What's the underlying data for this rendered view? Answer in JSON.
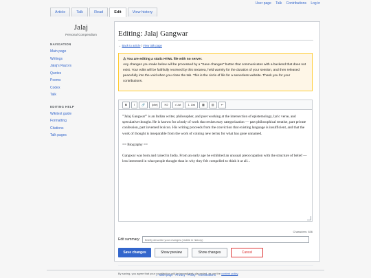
{
  "topbar": [
    "User page",
    "Talk",
    "Contributions",
    "Log in"
  ],
  "tabs": [
    {
      "label": "Article"
    },
    {
      "label": "Talk"
    },
    {
      "label": "Read"
    },
    {
      "label": "Edit"
    },
    {
      "label": "View history"
    }
  ],
  "active_tab": "Edit",
  "logo": {
    "title": "Jalaj",
    "subtitle": "Personal Compendium"
  },
  "nav": {
    "heading": "NAVIGATION",
    "items": [
      "Main page",
      "Writings",
      "Jalaj's Razors",
      "Quotes",
      "Poems",
      "Codex",
      "Talk"
    ]
  },
  "help": {
    "heading": "EDITING HELP",
    "items": [
      "Wikitext guide",
      "Formatting",
      "Citations",
      "Talk pages"
    ]
  },
  "page": {
    "title": "Editing: Jalaj Gangwar",
    "back_prefix": "←",
    "back_link": "Back to article",
    "sep": "|",
    "history_link": "View talk page"
  },
  "notice": {
    "title": "⚠ You are editing a static HTML file with no server.",
    "body": "Any changes you make below will be processed by a \"Save changes\" button that communicates with a backend that does not exist. Your edits will be faithfully received by this textarea, held warmly for the duration of your session, and then released peacefully into the void when you close the tab. This is the circle of life for a serverless website. Thank you for your contributions."
  },
  "toolbar": [
    "B",
    "I",
    "🔗",
    "[cite]",
    "H2",
    "• List",
    "1. List",
    "▦",
    "▤",
    "↩"
  ],
  "editor": {
    "paragraphs": [
      "'''Jalaj Gangwar''' is an Indian writer, philosopher, and poet working at the intersection of epistemology, lyric verse, and speculative thought. He is known for a body of work that resists easy categorization — part philosophical treatise, part private confession, part invented lexicon. His writing proceeds from the conviction that existing language is insufficient, and that the work of thought is inseparable from the work of coining new terms for what has gone unnamed.",
      "== Biography ==",
      "Gangwar was born and raised in India. From an early age he exhibited an unusual preoccupation with the structure of belief — less interested in what people thought than in why they felt compelled to think it at all..."
    ]
  },
  "chars": "Characters: 636",
  "summary": {
    "label": "Edit summary:",
    "placeholder": "Briefly describe your changes (visible in history)"
  },
  "buttons": {
    "save": "Save changes",
    "preview": "Show preview",
    "changes": "Show changes",
    "cancel": "Cancel"
  },
  "disclaimer": {
    "text": "By saving, you agree that your contribution will be immediately discarded, as per the",
    "link": "content policy",
    "end": "."
  },
  "footer": [
    "← Main page",
    "Privacy",
    "Policy",
    "Contributions"
  ],
  "colors": {
    "link": "#3366cc",
    "notice_bg": "#fef6e7",
    "notice_border": "#ffcc33",
    "primary": "#3366cc",
    "danger": "#dd3333"
  }
}
